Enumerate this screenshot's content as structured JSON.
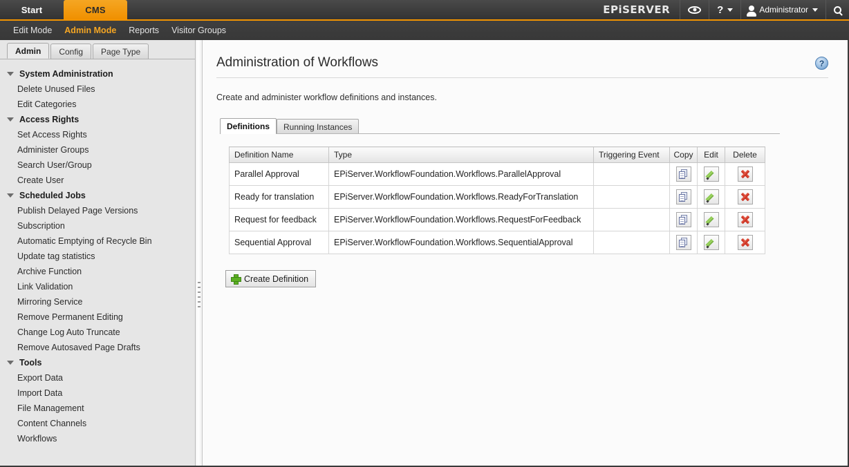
{
  "topbar": {
    "tabs": [
      {
        "label": "Start",
        "active": false
      },
      {
        "label": "CMS",
        "active": true
      }
    ],
    "brand": "EPiSERVER",
    "eye_icon": "eye-icon",
    "help_icon": "question-mark-icon",
    "user": "Administrator",
    "user_icon": "person-icon",
    "search_icon": "search-icon",
    "accent_color": "#f29400"
  },
  "menubar": {
    "items": [
      {
        "label": "Edit Mode",
        "active": false
      },
      {
        "label": "Admin Mode",
        "active": true
      },
      {
        "label": "Reports",
        "active": false
      },
      {
        "label": "Visitor Groups",
        "active": false
      }
    ]
  },
  "sidebar": {
    "tabs": [
      {
        "label": "Admin",
        "active": true
      },
      {
        "label": "Config",
        "active": false
      },
      {
        "label": "Page Type",
        "active": false
      }
    ],
    "sections": [
      {
        "title": "System Administration",
        "items": [
          "Delete Unused Files",
          "Edit Categories"
        ]
      },
      {
        "title": "Access Rights",
        "items": [
          "Set Access Rights",
          "Administer Groups",
          "Search User/Group",
          "Create User"
        ]
      },
      {
        "title": "Scheduled Jobs",
        "items": [
          "Publish Delayed Page Versions",
          "Subscription",
          "Automatic Emptying of Recycle Bin",
          "Update tag statistics",
          "Archive Function",
          "Link Validation",
          "Mirroring Service",
          "Remove Permanent Editing",
          "Change Log Auto Truncate",
          "Remove Autosaved Page Drafts"
        ]
      },
      {
        "title": "Tools",
        "items": [
          "Export Data",
          "Import Data",
          "File Management",
          "Content Channels",
          "Workflows"
        ]
      }
    ]
  },
  "main": {
    "title": "Administration of Workflows",
    "help_icon_label": "?",
    "description": "Create and administer workflow definitions and instances.",
    "tabs": [
      {
        "label": "Definitions",
        "active": true
      },
      {
        "label": "Running Instances",
        "active": false
      }
    ],
    "table": {
      "columns": [
        "Definition Name",
        "Type",
        "Triggering Event",
        "Copy",
        "Edit",
        "Delete"
      ],
      "rows": [
        {
          "name": "Parallel Approval",
          "type": "EPiServer.WorkflowFoundation.Workflows.ParallelApproval",
          "triggering_event": ""
        },
        {
          "name": "Ready for translation",
          "type": "EPiServer.WorkflowFoundation.Workflows.ReadyForTranslation",
          "triggering_event": ""
        },
        {
          "name": "Request for feedback",
          "type": "EPiServer.WorkflowFoundation.Workflows.RequestForFeedback",
          "triggering_event": ""
        },
        {
          "name": "Sequential Approval",
          "type": "EPiServer.WorkflowFoundation.Workflows.SequentialApproval",
          "triggering_event": ""
        }
      ],
      "row_icons": {
        "copy": "copy-icon",
        "edit": "pencil-icon",
        "delete": "delete-x-icon"
      }
    },
    "create_button": {
      "label": "Create Definition",
      "icon": "plus-icon"
    }
  }
}
